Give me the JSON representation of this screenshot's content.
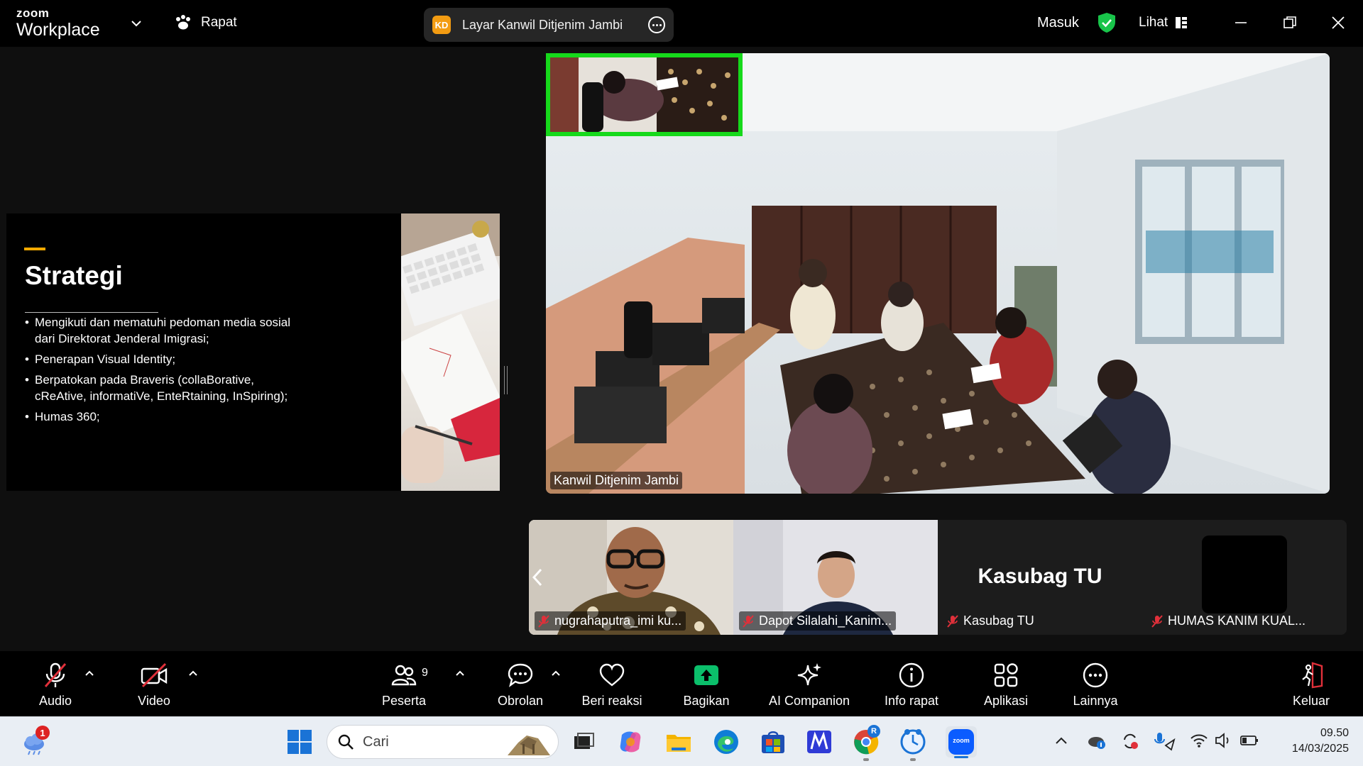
{
  "topbar": {
    "brand_top": "zoom",
    "brand_bottom": "Workplace",
    "meeting_label": "Rapat",
    "share_badge": "KD",
    "share_label": "Layar Kanwil Ditjenim Jambi",
    "signin_label": "Masuk",
    "view_label": "Lihat"
  },
  "slide": {
    "title": "Strategi",
    "bullets": [
      "Mengikuti dan mematuhi pedoman media sosial dari Direktorat Jenderal Imigrasi;",
      "Penerapan Visual Identity;",
      "Berpatokan pada Braveris (collaBorative, cReAtive, informatiVe, EnteRtaining, InSpiring);",
      "Humas 360;"
    ]
  },
  "main_video": {
    "label": "Kanwil Ditjenim Jambi"
  },
  "participants": [
    {
      "name": "nugrahaputra_imi ku..."
    },
    {
      "name": "Dapot Silalahi_Kanim..."
    },
    {
      "name": "Kasubag TU",
      "display": "Kasubag TU"
    },
    {
      "name": "HUMAS KANIM KUAL..."
    }
  ],
  "toolbar": {
    "audio": "Audio",
    "video": "Video",
    "participants": "Peserta",
    "participants_count": "9",
    "chat": "Obrolan",
    "react": "Beri reaksi",
    "share": "Bagikan",
    "ai": "AI Companion",
    "info": "Info rapat",
    "apps": "Aplikasi",
    "more": "Lainnya",
    "leave": "Keluar"
  },
  "taskbar": {
    "search_placeholder": "Cari",
    "weather_badge": "1",
    "chrome_profile": "R",
    "zoom_icon_text": "zoom",
    "time": "09.50",
    "date": "14/03/2025"
  },
  "colors": {
    "active_speaker": "#16d91b",
    "accent": "#f2a900",
    "share_green": "#0bbf6b",
    "mute_red": "#e0303a"
  }
}
